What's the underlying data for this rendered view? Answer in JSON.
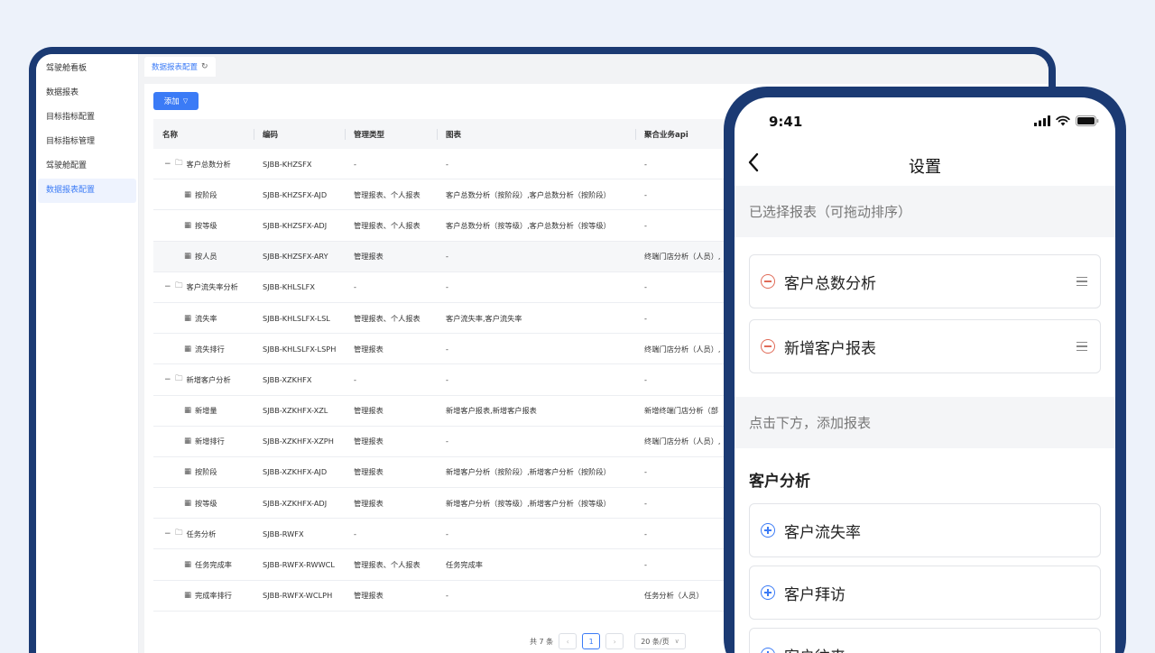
{
  "sidebar": {
    "items": [
      "驾驶舱看板",
      "数据报表",
      "目标指标配置",
      "目标指标管理",
      "驾驶舱配置",
      "数据报表配置"
    ],
    "active_index": 5,
    "collapse_icon": "menu-fold-icon"
  },
  "tabs": [
    {
      "label": "数据报表配置",
      "icon": "refresh-icon"
    }
  ],
  "toolbar": {
    "add_label": "添加"
  },
  "table": {
    "headers": [
      "名称",
      "编码",
      "管理类型",
      "图表",
      "聚合业务api"
    ],
    "rows": [
      {
        "level": "parent",
        "name": "客户总数分析",
        "code": "SJBB-KHZSFX",
        "type": "-",
        "chart": "-",
        "api": "-"
      },
      {
        "level": "child",
        "name": "按阶段",
        "code": "SJBB-KHZSFX-AJD",
        "type": "管理报表、个人报表",
        "chart": "客户总数分析（按阶段）,客户总数分析（按阶段）",
        "api": "-"
      },
      {
        "level": "child",
        "name": "按等级",
        "code": "SJBB-KHZSFX-ADJ",
        "type": "管理报表、个人报表",
        "chart": "客户总数分析（按等级）,客户总数分析（按等级）",
        "api": "-"
      },
      {
        "level": "child",
        "name": "按人员",
        "code": "SJBB-KHZSFX-ARY",
        "type": "管理报表",
        "chart": "-",
        "api": "终端门店分析（人员）,",
        "highlight": true
      },
      {
        "level": "parent",
        "name": "客户流失率分析",
        "code": "SJBB-KHLSLFX",
        "type": "-",
        "chart": "-",
        "api": "-"
      },
      {
        "level": "child",
        "name": "流失率",
        "code": "SJBB-KHLSLFX-LSL",
        "type": "管理报表、个人报表",
        "chart": "客户流失率,客户流失率",
        "api": "-"
      },
      {
        "level": "child",
        "name": "流失排行",
        "code": "SJBB-KHLSLFX-LSPH",
        "type": "管理报表",
        "chart": "-",
        "api": "终端门店分析（人员）,"
      },
      {
        "level": "parent",
        "name": "新增客户分析",
        "code": "SJBB-XZKHFX",
        "type": "-",
        "chart": "-",
        "api": "-"
      },
      {
        "level": "child",
        "name": "新增量",
        "code": "SJBB-XZKHFX-XZL",
        "type": "管理报表",
        "chart": "新增客户报表,新增客户报表",
        "api": "新增终端门店分析（部"
      },
      {
        "level": "child",
        "name": "新增排行",
        "code": "SJBB-XZKHFX-XZPH",
        "type": "管理报表",
        "chart": "-",
        "api": "终端门店分析（人员）,"
      },
      {
        "level": "child",
        "name": "按阶段",
        "code": "SJBB-XZKHFX-AJD",
        "type": "管理报表",
        "chart": "新增客户分析（按阶段）,新增客户分析（按阶段）",
        "api": "-"
      },
      {
        "level": "child",
        "name": "按等级",
        "code": "SJBB-XZKHFX-ADJ",
        "type": "管理报表",
        "chart": "新增客户分析（按等级）,新增客户分析（按等级）",
        "api": "-"
      },
      {
        "level": "parent",
        "name": "任务分析",
        "code": "SJBB-RWFX",
        "type": "-",
        "chart": "-",
        "api": "-"
      },
      {
        "level": "child",
        "name": "任务完成率",
        "code": "SJBB-RWFX-RWWCL",
        "type": "管理报表、个人报表",
        "chart": "任务完成率",
        "api": "-"
      },
      {
        "level": "child",
        "name": "完成率排行",
        "code": "SJBB-RWFX-WCLPH",
        "type": "管理报表",
        "chart": "-",
        "api": "任务分析（人员）"
      }
    ]
  },
  "pagination": {
    "total": "共 7 条",
    "current_page": "1",
    "page_size": "20 条/页"
  },
  "phone": {
    "time": "9:41",
    "title": "设置",
    "selected_header": "已选择报表（可拖动排序）",
    "selected": [
      "客户总数分析",
      "新增客户报表"
    ],
    "add_header": "点击下方，添加报表",
    "group_title": "客户分析",
    "available": [
      "客户流失率",
      "客户拜访",
      "客户往来"
    ]
  }
}
